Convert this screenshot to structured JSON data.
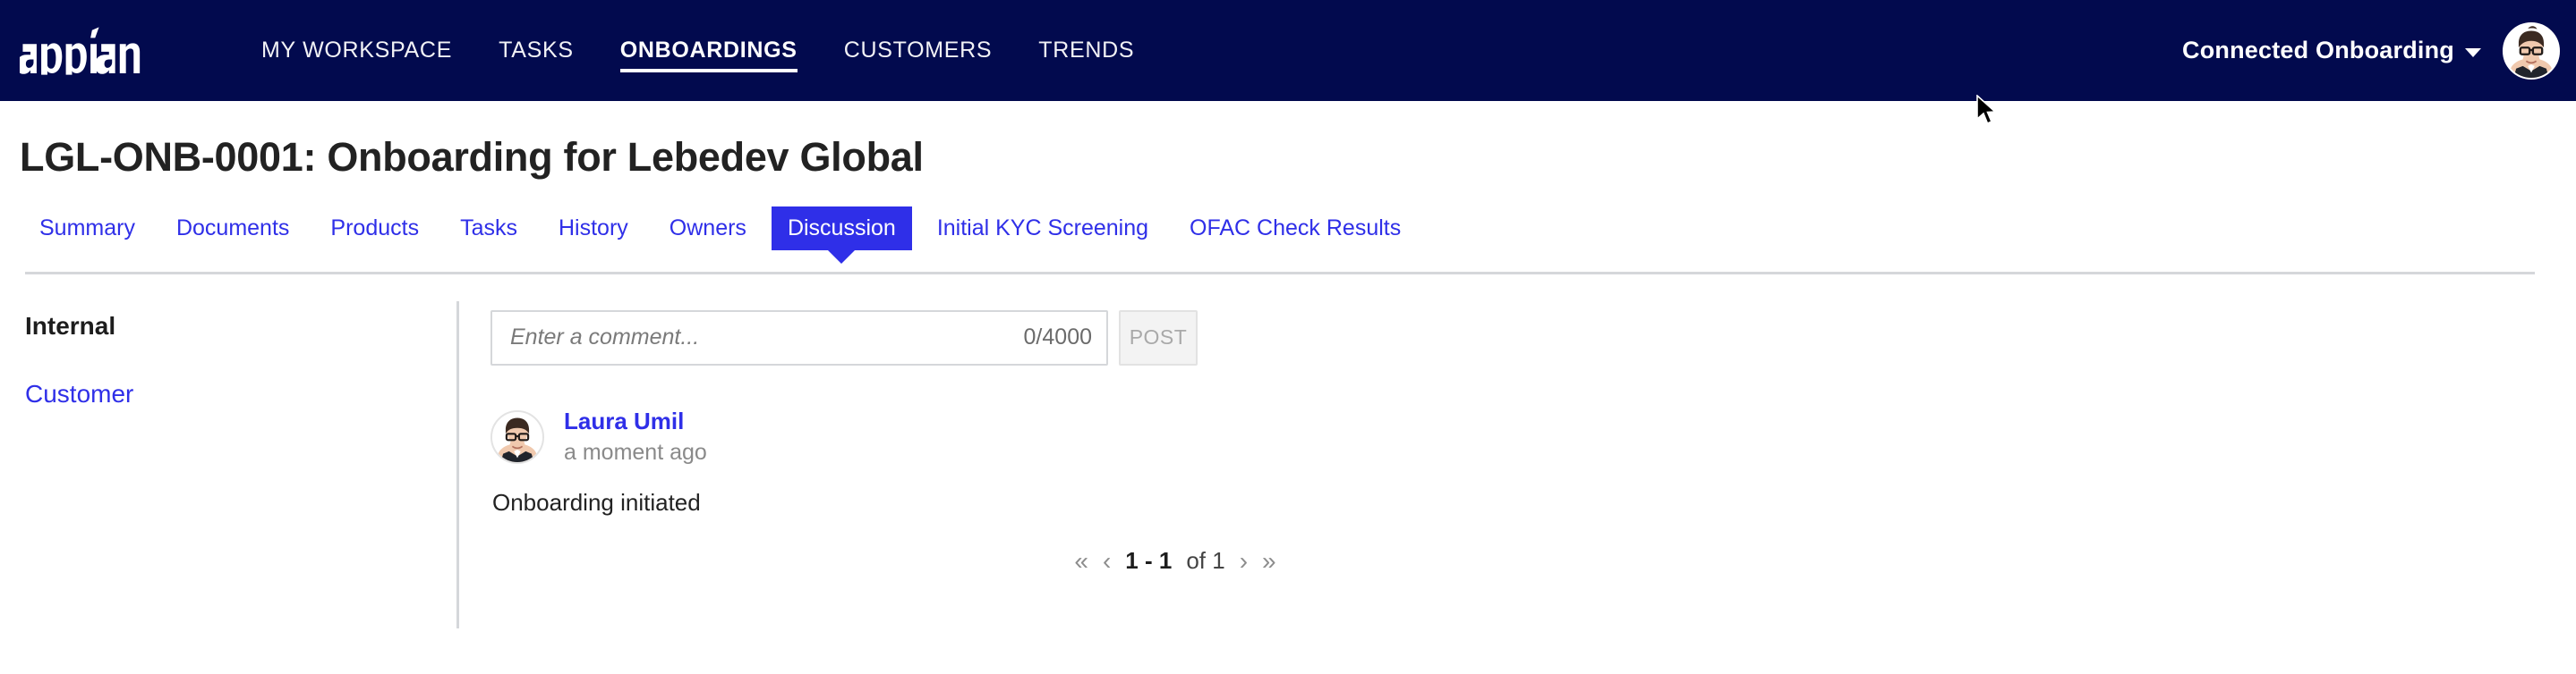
{
  "brand": {
    "name": "appian"
  },
  "topnav": {
    "links": [
      {
        "label": "MY WORKSPACE",
        "active": false
      },
      {
        "label": "TASKS",
        "active": false
      },
      {
        "label": "ONBOARDINGS",
        "active": true
      },
      {
        "label": "CUSTOMERS",
        "active": false
      },
      {
        "label": "TRENDS",
        "active": false
      }
    ],
    "user_menu_label": "Connected Onboarding",
    "caret_icon": "chevron-down-icon",
    "avatar_icon": "user-avatar"
  },
  "page": {
    "title": "LGL-ONB-0001: Onboarding for Lebedev Global"
  },
  "tabs": [
    {
      "label": "Summary",
      "active": false
    },
    {
      "label": "Documents",
      "active": false
    },
    {
      "label": "Products",
      "active": false
    },
    {
      "label": "Tasks",
      "active": false
    },
    {
      "label": "History",
      "active": false
    },
    {
      "label": "Owners",
      "active": false
    },
    {
      "label": "Discussion",
      "active": true
    },
    {
      "label": "Initial KYC Screening",
      "active": false
    },
    {
      "label": "OFAC Check Results",
      "active": false
    }
  ],
  "sidebar": {
    "items": [
      {
        "label": "Internal",
        "active": true
      },
      {
        "label": "Customer",
        "active": false
      }
    ]
  },
  "composer": {
    "placeholder": "Enter a comment...",
    "value": "",
    "char_count": "0/4000",
    "post_label": "POST"
  },
  "comments": [
    {
      "author": "Laura Umil",
      "time": "a moment ago",
      "text": "Onboarding initiated"
    }
  ],
  "pagination": {
    "first": "«",
    "prev": "‹",
    "range": "1 - 1",
    "of": "of 1",
    "next": "›",
    "last": "»"
  },
  "colors": {
    "nav_background": "#020A4E",
    "accent_blue": "#2F2FE8",
    "divider": "#d5d7da",
    "title_text": "#222222"
  }
}
